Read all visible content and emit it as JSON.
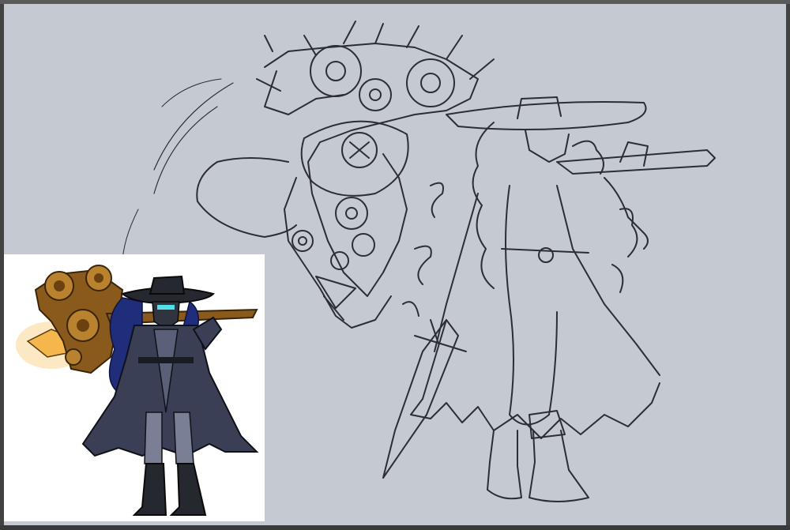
{
  "window": {
    "title": ""
  },
  "canvas": {
    "background_color": "#c5cad2",
    "sketch_line_color": "#2b2e33"
  },
  "reference_image": {
    "description_icon": "character-reference-icon",
    "palette": [
      "#3b3f55",
      "#1f2d7a",
      "#8a5a1c",
      "#f5b74c",
      "#25292f"
    ]
  }
}
